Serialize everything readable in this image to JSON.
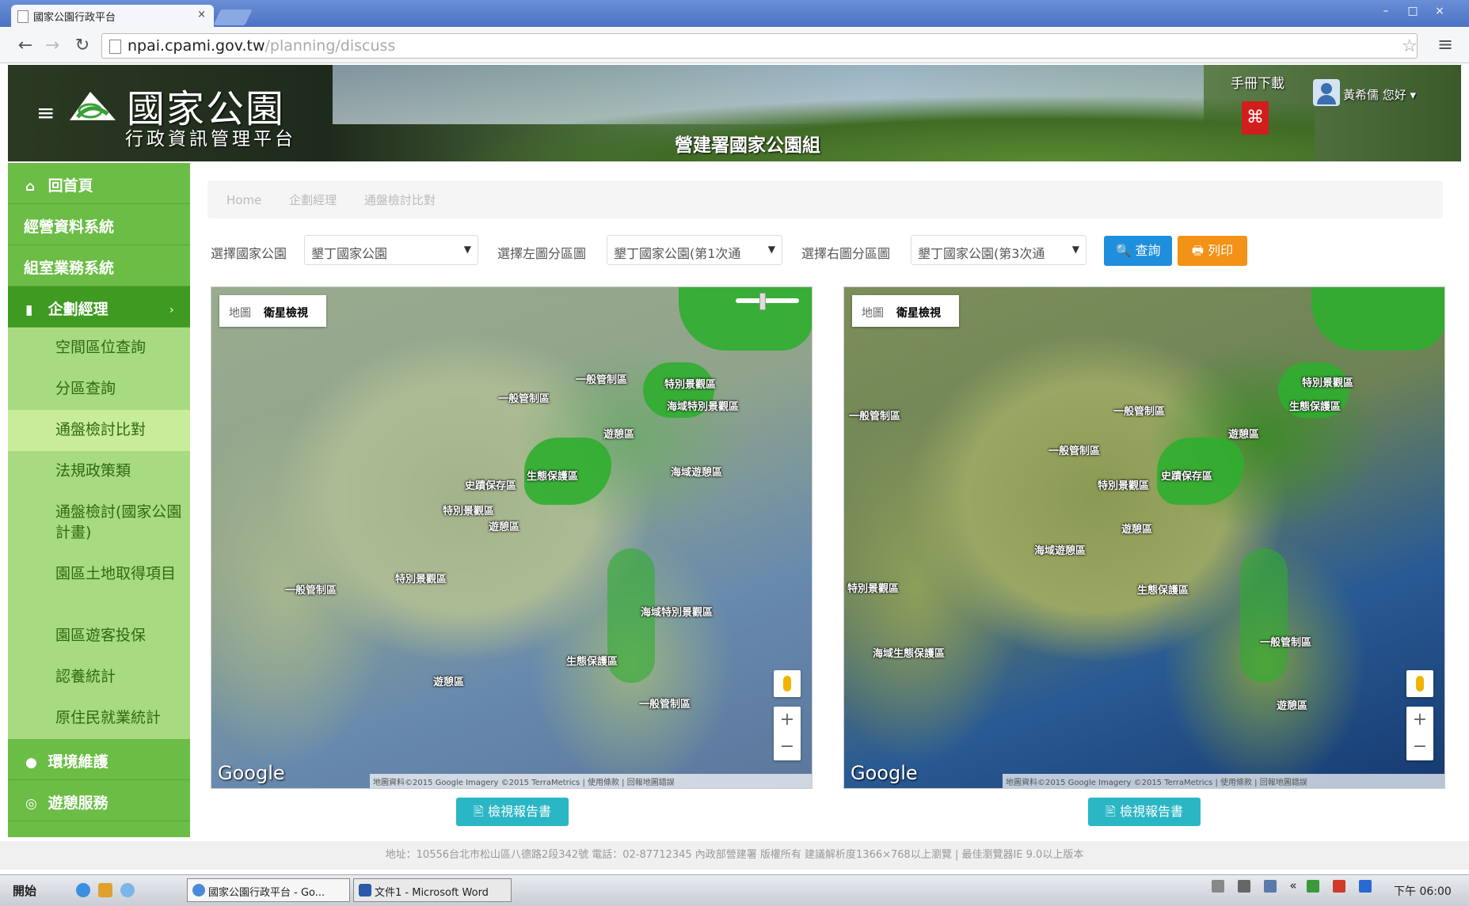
{
  "browser": {
    "tab_title": "國家公園行政平台",
    "tab_close": "×",
    "url_host": "npai.cpami.gov.tw",
    "url_path": "/planning/discuss",
    "window_controls": [
      "–",
      "□",
      "×"
    ]
  },
  "header": {
    "menu_glyph": "≡",
    "title": "國家公園",
    "subtitle": "行政資訊管理平台",
    "agency": "營建署國家公園組",
    "manual_label": "手冊下載",
    "pdf_icon_label": "PDF",
    "user_greeting": "黃希儒 您好 ▾"
  },
  "sidebar": {
    "items": [
      {
        "label": "回首頁",
        "icon": "home-icon",
        "glyph": "⌂"
      },
      {
        "label": "經營資料系統",
        "icon": "",
        "glyph": ""
      },
      {
        "label": "組室業務系統",
        "icon": "",
        "glyph": ""
      },
      {
        "label": "企劃經理",
        "icon": "file-icon",
        "glyph": "▮"
      }
    ],
    "subitems": [
      "空間區位查詢",
      "分區查詢",
      "通盤檢討比對",
      "法規政策類",
      "通盤檢討(國家公園計畫)",
      "園區土地取得項目",
      "園區遊客投保",
      "認養統計",
      "原住民就業統計"
    ],
    "bottom_items": [
      {
        "label": "環境維護",
        "glyph": "●"
      },
      {
        "label": "遊憩服務",
        "glyph": "◎"
      }
    ],
    "expand_glyph": "›"
  },
  "breadcrumb": [
    "Home",
    "企劃經理",
    "通盤檢討比對"
  ],
  "filters": {
    "park_label": "選擇國家公園",
    "park_value": "墾丁國家公園",
    "left_label": "選擇左圖分區圖",
    "left_value": "墾丁國家公園(第1次通",
    "right_label": "選擇右圖分區圖",
    "right_value": "墾丁國家公園(第3次通",
    "caret": "▼",
    "query_label": "🔍 查詢",
    "print_label": "🖶 列印"
  },
  "map": {
    "type_map": "地圖",
    "type_satellite": "衛星檢視",
    "google": "Google",
    "zoom_in": "+",
    "zoom_out": "−",
    "attrib_left": "地圖資料©2015 Google Imagery ©2015 TerraMetrics | 使用條款 | 回報地圖錯誤",
    "attrib_right": "地圖資料©2015 Google Imagery ©2015 TerraMetrics | 使用條款 | 回報地圖錯誤",
    "report_label": "🖹 檢視報告書",
    "places_left": [
      "一般管制區",
      "特別景觀區",
      "海域特別景觀區",
      "遊憩區",
      "生態保護區",
      "史蹟保存區",
      "一般管制區",
      "特別景觀區",
      "遊憩區",
      "海域遊憩區",
      "特別景觀區",
      "一般管制區",
      "海域特別景觀區",
      "生態保護區",
      "遊憩區",
      "一般管制區"
    ],
    "places_right": [
      "一般管制區",
      "特別景觀區",
      "生態保護區",
      "一般管制區",
      "遊憩區",
      "特別景觀區",
      "史蹟保存區",
      "海域遊憩區",
      "一般管制區",
      "遊憩區",
      "特別景觀區",
      "海域生態保護區",
      "一般管制區",
      "生態保護區",
      "遊憩區"
    ]
  },
  "footer": "地址：10556台北市松山區八德路2段342號 電話：02-87712345 內政部營建署 版權所有 建議解析度1366×768以上瀏覽 | 最佳瀏覽器IE 9.0以上版本",
  "taskbar": {
    "start_label": "開始",
    "task1": "國家公園行政平台 - Go...",
    "task2": "文件1 - Microsoft Word",
    "clock": "下午 06:00",
    "tray_glyph": "«"
  },
  "colors": {
    "sidebar": "#6bbd45",
    "sidebar_active": "#3f9a22",
    "query_button": "#1e8fdc",
    "print_button": "#f39216",
    "report_button": "#2bb6c6"
  }
}
